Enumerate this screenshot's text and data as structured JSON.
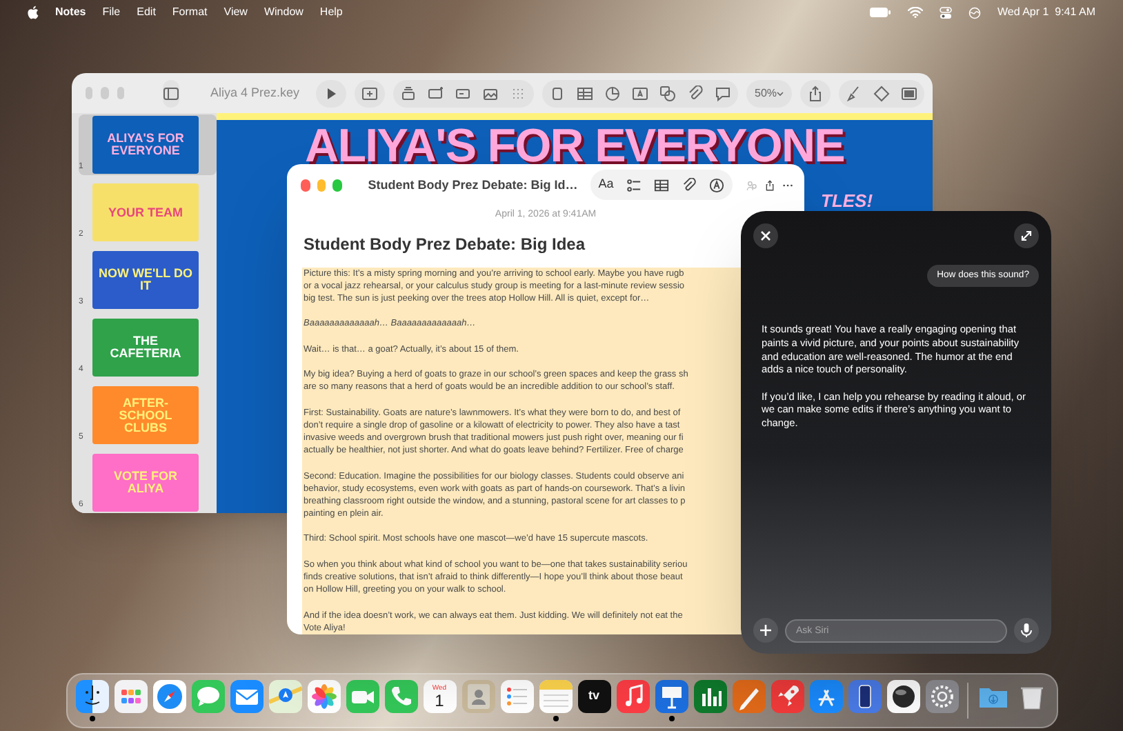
{
  "menu_bar": {
    "app_name": "Notes",
    "menus": [
      "File",
      "Edit",
      "Format",
      "View",
      "Window",
      "Help"
    ],
    "clock": "Wed Apr 1  9:41 AM"
  },
  "keynote_window": {
    "title": "Aliya 4 Prez.key",
    "zoom": "50%",
    "slides": [
      {
        "number": "1",
        "title": "ALIYA'S FOR EVERYONE",
        "selected": true
      },
      {
        "number": "2",
        "title": "YOUR TEAM",
        "selected": false
      },
      {
        "number": "3",
        "title": "NOW WE'LL DO IT",
        "selected": false
      },
      {
        "number": "4",
        "title": "THE CAFETERIA",
        "selected": false
      },
      {
        "number": "5",
        "title": "AFTER-SCHOOL CLUBS",
        "selected": false
      },
      {
        "number": "6",
        "title": "VOTE FOR ALIYA",
        "selected": false
      }
    ],
    "slide_canvas": {
      "headline": "ALIYA'S FOR EVERYONE",
      "partial_text": "TLES!"
    }
  },
  "notes_window": {
    "title": "Student Body Prez Debate: Big Id…",
    "format_button": "Aa",
    "date": "April 1, 2026 at 9:41AM",
    "heading": "Student Body Prez Debate: Big Idea",
    "body": {
      "highlighted": true,
      "paragraphs": [
        {
          "italic": false,
          "lines": [
            "Picture this: It’s a misty spring morning and you’re arriving to school early. Maybe you have rugb",
            "or a vocal jazz rehearsal, or your calculus study group is meeting for a last-minute review sessio",
            "big test. The sun is just peeking over the trees atop Hollow Hill. All is quiet, except for…"
          ]
        },
        {
          "italic": true,
          "lines": [
            "Baaaaaaaaaaaaah… Baaaaaaaaaaaaah…"
          ]
        },
        {
          "italic": false,
          "lines": [
            "Wait… is that… a goat? Actually, it’s about 15 of them."
          ]
        },
        {
          "italic": false,
          "lines": [
            "My big idea? Buying a herd of goats to graze in our school’s green spaces and keep the grass sh",
            "are so many reasons that a herd of goats would be an incredible addition to our school’s staff."
          ]
        },
        {
          "italic": false,
          "lines": [
            "First: Sustainability. Goats are nature’s lawnmowers. It’s what they were born to do, and best of",
            "don’t require a single drop of gasoline or a kilowatt of electricity to power. They also have a tast",
            "invasive weeds and overgrown brush that traditional mowers just push right over, meaning our fi",
            "actually be healthier, not just shorter. And what do goats leave behind? Fertilizer. Free of charge"
          ]
        },
        {
          "italic": false,
          "lines": [
            "Second: Education. Imagine the possibilities for our biology classes. Students could observe ani",
            "behavior, study ecosystems, even work with goats as part of hands-on coursework. That’s a livin",
            "breathing classroom right outside the window, and a stunning, pastoral scene for art classes to p",
            "painting en plein air."
          ]
        },
        {
          "italic": false,
          "lines": [
            "Third: School spirit. Most schools have one mascot—we’d have 15 supercute mascots."
          ]
        },
        {
          "italic": false,
          "lines": [
            "So when you think about what kind of school you want to be—one that takes sustainability seriou",
            "finds creative solutions, that isn’t afraid to think differently—I hope you’ll think about those beaut",
            "on Hollow Hill, greeting you on your walk to school."
          ]
        },
        {
          "italic": false,
          "lines": [
            "And if the idea doesn’t work, we can always eat them. Just kidding. We will definitely not eat the",
            "Vote Aliya!"
          ]
        }
      ]
    }
  },
  "siri": {
    "question": "How does this sound?",
    "response": [
      "It sounds great! You have a really engaging opening that paints a vivid picture, and your points about sustainability and education are well-reasoned. The humor at the end adds a nice touch of personality.",
      "If you’d like, I can help you rehearse by reading it aloud, or we can make some edits if there’s anything you want to change."
    ],
    "input": {
      "placeholder": "Ask Siri"
    }
  },
  "dock": {
    "apps": [
      {
        "kind": "finder",
        "running": true
      },
      {
        "kind": "launchpad",
        "running": false
      },
      {
        "kind": "safari",
        "running": false
      },
      {
        "kind": "messages",
        "running": false
      },
      {
        "kind": "mail",
        "running": false
      },
      {
        "kind": "maps",
        "running": false
      },
      {
        "kind": "photos",
        "running": false
      },
      {
        "kind": "facetime",
        "running": false
      },
      {
        "kind": "phone",
        "running": false
      },
      {
        "kind": "calendar",
        "running": false,
        "weekday": "Wed",
        "day": "1"
      },
      {
        "kind": "contacts",
        "running": false
      },
      {
        "kind": "reminders",
        "running": false
      },
      {
        "kind": "notes",
        "running": true
      },
      {
        "kind": "tv",
        "running": false,
        "label": "tv"
      },
      {
        "kind": "music",
        "running": false
      },
      {
        "kind": "keynote",
        "running": true
      },
      {
        "kind": "numbers",
        "running": false
      },
      {
        "kind": "pages",
        "running": false
      },
      {
        "kind": "rocket",
        "running": false
      },
      {
        "kind": "appstore",
        "running": false
      },
      {
        "kind": "simulator",
        "running": false
      },
      {
        "kind": "sphere",
        "running": false
      },
      {
        "kind": "settings",
        "running": false
      },
      {
        "kind": "separator"
      },
      {
        "kind": "downloads",
        "running": false
      },
      {
        "kind": "trash",
        "running": false
      }
    ]
  }
}
